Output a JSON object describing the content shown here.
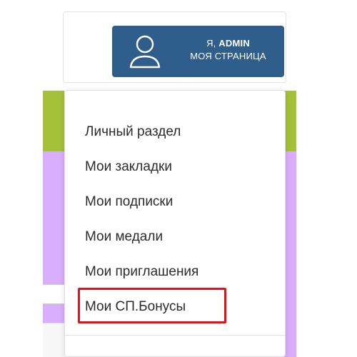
{
  "user_button": {
    "greeting_prefix": "Я, ",
    "username": "ADMIN",
    "subtitle": "МОЯ СТРАНИЦА",
    "icon": "user-icon"
  },
  "dropdown": {
    "items": [
      {
        "label": "Личный раздел"
      },
      {
        "label": "Мои закладки"
      },
      {
        "label": "Мои подписки"
      },
      {
        "label": "Мои медали"
      },
      {
        "label": "Мои приглашения"
      },
      {
        "label": "Мои СП.Бонусы",
        "highlighted": true
      }
    ]
  },
  "colors": {
    "button_bg": "#2f5d8c",
    "highlight_border": "#e0131d",
    "green_band": "#a4c13a",
    "purple_bg": "#d9aefc"
  }
}
